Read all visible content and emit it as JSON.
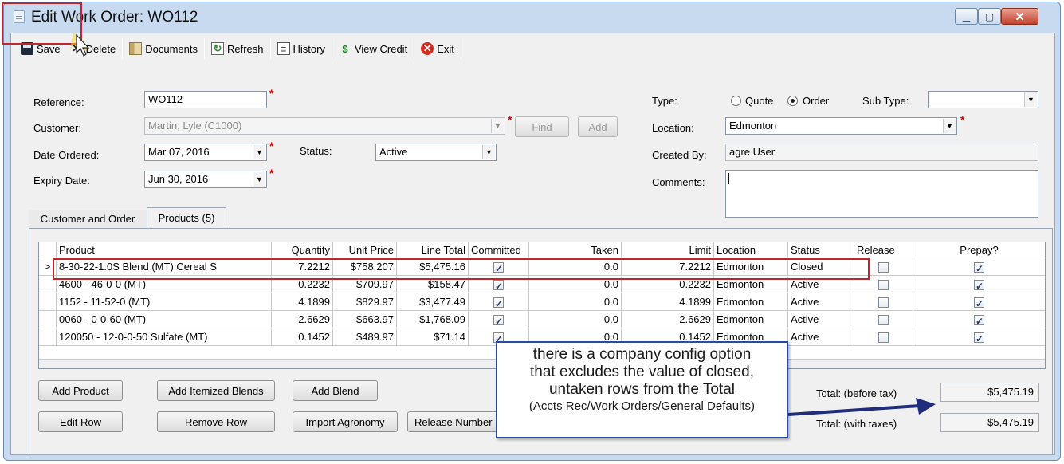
{
  "window": {
    "title": "Edit Work Order: WO112"
  },
  "toolbar": {
    "items": [
      {
        "label": "Save",
        "icon": "floppy-disk-icon"
      },
      {
        "label": "Delete",
        "icon": "x-icon"
      },
      {
        "label": "Documents",
        "icon": "folder-icon"
      },
      {
        "label": "Refresh",
        "icon": "refresh-icon"
      },
      {
        "label": "History",
        "icon": "history-icon"
      },
      {
        "label": "View Credit",
        "icon": "dollar-icon"
      },
      {
        "label": "Exit",
        "icon": "exit-icon"
      }
    ]
  },
  "form": {
    "reference_label": "Reference:",
    "reference_value": "WO112",
    "customer_label": "Customer:",
    "customer_value": "Martin, Lyle (C1000)",
    "find_button": "Find",
    "add_button": "Add",
    "date_ordered_label": "Date Ordered:",
    "date_ordered_value": "Mar 07, 2016",
    "status_label": "Status:",
    "status_value": "Active",
    "expiry_label": "Expiry Date:",
    "expiry_value": "Jun 30, 2016",
    "type_label": "Type:",
    "type_quote": "Quote",
    "type_order": "Order",
    "type_selected": "Order",
    "subtype_label": "Sub Type:",
    "subtype_value": "",
    "location_label": "Location:",
    "location_value": "Edmonton",
    "created_by_label": "Created By:",
    "created_by_value": "agre User",
    "comments_label": "Comments:",
    "comments_value": ""
  },
  "tabs": [
    {
      "label": "Customer and Order",
      "active": false
    },
    {
      "label": "Products (5)",
      "active": true
    }
  ],
  "grid": {
    "columns": [
      "Product",
      "Quantity",
      "Unit Price",
      "Line Total",
      "Committed",
      "Taken",
      "Limit",
      "Location",
      "Status",
      "Release",
      "Prepay?"
    ],
    "rows": [
      {
        "selected": true,
        "product": "8-30-22-1.0S Blend (MT) Cereal S",
        "quantity": "7.2212",
        "unit_price": "$758.207",
        "line_total": "$5,475.16",
        "committed": true,
        "taken": "0.0",
        "limit": "7.2212",
        "location": "Edmonton",
        "status": "Closed",
        "release": false,
        "prepay": true
      },
      {
        "selected": false,
        "product": "4600 - 46-0-0 (MT)",
        "quantity": "0.2232",
        "unit_price": "$709.97",
        "line_total": "$158.47",
        "committed": true,
        "taken": "0.0",
        "limit": "0.2232",
        "location": "Edmonton",
        "status": "Active",
        "release": false,
        "prepay": true
      },
      {
        "selected": false,
        "product": "1152 - 11-52-0 (MT)",
        "quantity": "4.1899",
        "unit_price": "$829.97",
        "line_total": "$3,477.49",
        "committed": true,
        "taken": "0.0",
        "limit": "4.1899",
        "location": "Edmonton",
        "status": "Active",
        "release": false,
        "prepay": true
      },
      {
        "selected": false,
        "product": "0060 - 0-0-60 (MT)",
        "quantity": "2.6629",
        "unit_price": "$663.97",
        "line_total": "$1,768.09",
        "committed": true,
        "taken": "0.0",
        "limit": "2.6629",
        "location": "Edmonton",
        "status": "Active",
        "release": false,
        "prepay": true
      },
      {
        "selected": false,
        "product": "120050 - 12-0-0-50 Sulfate (MT)",
        "quantity": "0.1452",
        "unit_price": "$489.97",
        "line_total": "$71.14",
        "committed": true,
        "taken": "0.0",
        "limit": "0.1452",
        "location": "Edmonton",
        "status": "Active",
        "release": false,
        "prepay": true
      }
    ],
    "row_marker": ">"
  },
  "buttons": {
    "add_product": "Add Product",
    "add_itemized_blends": "Add Itemized Blends",
    "add_blend": "Add Blend",
    "edit_row": "Edit Row",
    "remove_row": "Remove Row",
    "import_agronomy": "Import Agronomy",
    "release_numbers": "Release Number"
  },
  "totals": {
    "before_tax_label": "Total: (before tax)",
    "before_tax_value": "$5,475.19",
    "with_taxes_label": "Total: (with taxes)",
    "with_taxes_value": "$5,475.19"
  },
  "callout": {
    "line1": "there is a company config option",
    "line2": "that excludes the value of closed,",
    "line3": "untaken rows from the Total",
    "line4": "(Accts Rec/Work Orders/General Defaults)"
  },
  "colors": {
    "highlight": "#c0262d",
    "callout_border": "#2a4aa6",
    "arrow": "#1f2d7a"
  }
}
